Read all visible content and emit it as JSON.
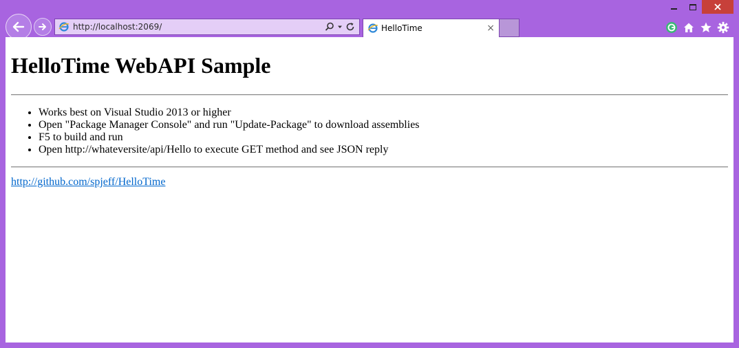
{
  "browser": {
    "address_url": "http://localhost:2069/",
    "tab_title": "HelloTime",
    "tab_close_glyph": "×",
    "icons": {
      "back": "back-arrow-icon",
      "forward": "forward-arrow-icon",
      "page": "ie-page-icon",
      "search": "search-icon",
      "dropdown": "dropdown-icon",
      "refresh": "refresh-icon",
      "extension": "extension-icon",
      "home": "home-icon",
      "favorites": "star-icon",
      "tools": "gear-icon",
      "minimize": "minimize-icon",
      "maximize": "maximize-icon",
      "close": "close-icon"
    },
    "colors": {
      "frame": "#a864e0",
      "close_button": "#c7403a",
      "link": "#0066cc"
    }
  },
  "page": {
    "heading": "HelloTime WebAPI Sample",
    "bullets": [
      "Works best on Visual Studio 2013 or higher",
      "Open \"Package Manager Console\" and run \"Update-Package\" to download assemblies",
      "F5 to build and run",
      "Open http://whateversite/api/Hello to execute GET method and see JSON reply"
    ],
    "repo_link": "http://github.com/spjeff/HelloTime"
  }
}
